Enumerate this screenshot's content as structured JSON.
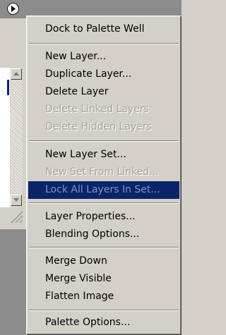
{
  "menu": {
    "items": [
      {
        "label": "Dock to Palette Well",
        "enabled": true,
        "highlighted": false
      },
      {
        "label": "New Layer...",
        "enabled": true,
        "highlighted": false
      },
      {
        "label": "Duplicate Layer...",
        "enabled": true,
        "highlighted": false
      },
      {
        "label": "Delete Layer",
        "enabled": true,
        "highlighted": false
      },
      {
        "label": "Delete Linked Layers",
        "enabled": false,
        "highlighted": false
      },
      {
        "label": "Delete Hidden Layers",
        "enabled": false,
        "highlighted": false
      },
      {
        "label": "New Layer Set...",
        "enabled": true,
        "highlighted": false
      },
      {
        "label": "New Set From Linked...",
        "enabled": false,
        "highlighted": false
      },
      {
        "label": "Lock All Layers In Set...",
        "enabled": false,
        "highlighted": true
      },
      {
        "label": "Layer Properties...",
        "enabled": true,
        "highlighted": false
      },
      {
        "label": "Blending Options...",
        "enabled": true,
        "highlighted": false
      },
      {
        "label": "Merge Down",
        "enabled": true,
        "highlighted": false
      },
      {
        "label": "Merge Visible",
        "enabled": true,
        "highlighted": false
      },
      {
        "label": "Flatten Image",
        "enabled": true,
        "highlighted": false
      },
      {
        "label": "Palette Options...",
        "enabled": true,
        "highlighted": false
      }
    ]
  },
  "icons": {
    "palette_menu": "palette-menu-arrow-icon",
    "scroll_up": "scroll-up-arrow-icon",
    "scroll_down": "scroll-down-arrow-icon",
    "resize": "resize-grip-icon"
  },
  "colors": {
    "highlight": "#0a246a",
    "menu_bg": "#d4d0c8",
    "disabled_text": "#a8a49c"
  }
}
